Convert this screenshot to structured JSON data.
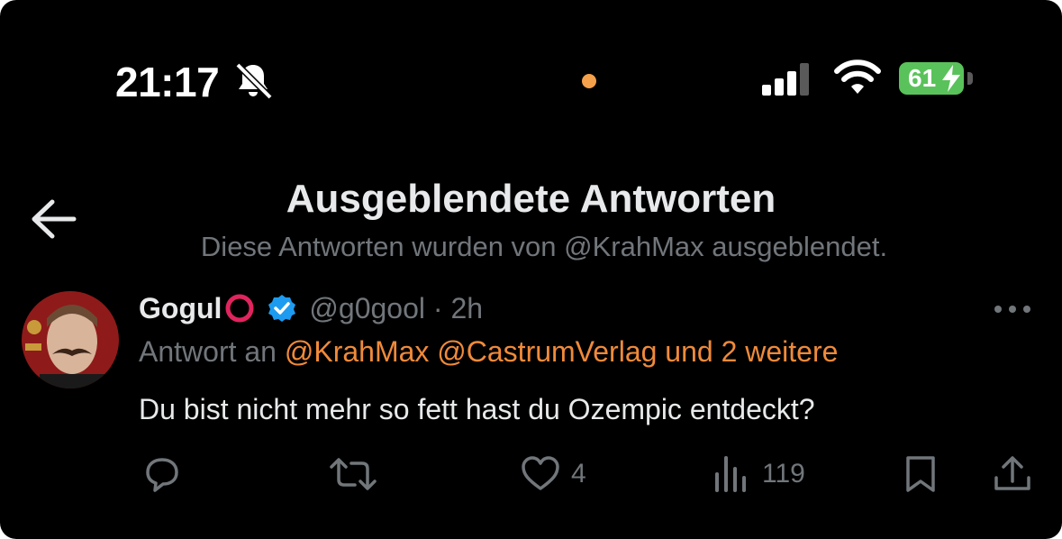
{
  "status_bar": {
    "time": "21:17",
    "battery": "61",
    "icons": [
      "bell-slash-icon",
      "signal-icon",
      "wifi-icon",
      "battery-icon",
      "bolt-icon"
    ],
    "indicator_color": "#f5a04a",
    "battery_color": "#5ac25a"
  },
  "header": {
    "title": "Ausgeblendete Antworten",
    "subtitle": "Diese Antworten wurden von @KrahMax ausgeblendet."
  },
  "tweet": {
    "author_name": "Gogul",
    "handle": "@g0gool",
    "time": "· 2h",
    "reply_prefix": "Antwort an",
    "reply_mentions": "@KrahMax @CastrumVerlag und 2 weitere",
    "text": "Du bist nicht mehr so fett hast du Ozempic entdeckt?",
    "actions": {
      "reply_count": "",
      "retweet_count": "",
      "like_count": "4",
      "views_count": "119"
    }
  },
  "colors": {
    "background": "#000000",
    "text_primary": "#e7e9ea",
    "text_secondary": "#71767b",
    "mention": "#f08a3a",
    "verified": "#1d9bf0",
    "ring": "#e0245e"
  }
}
